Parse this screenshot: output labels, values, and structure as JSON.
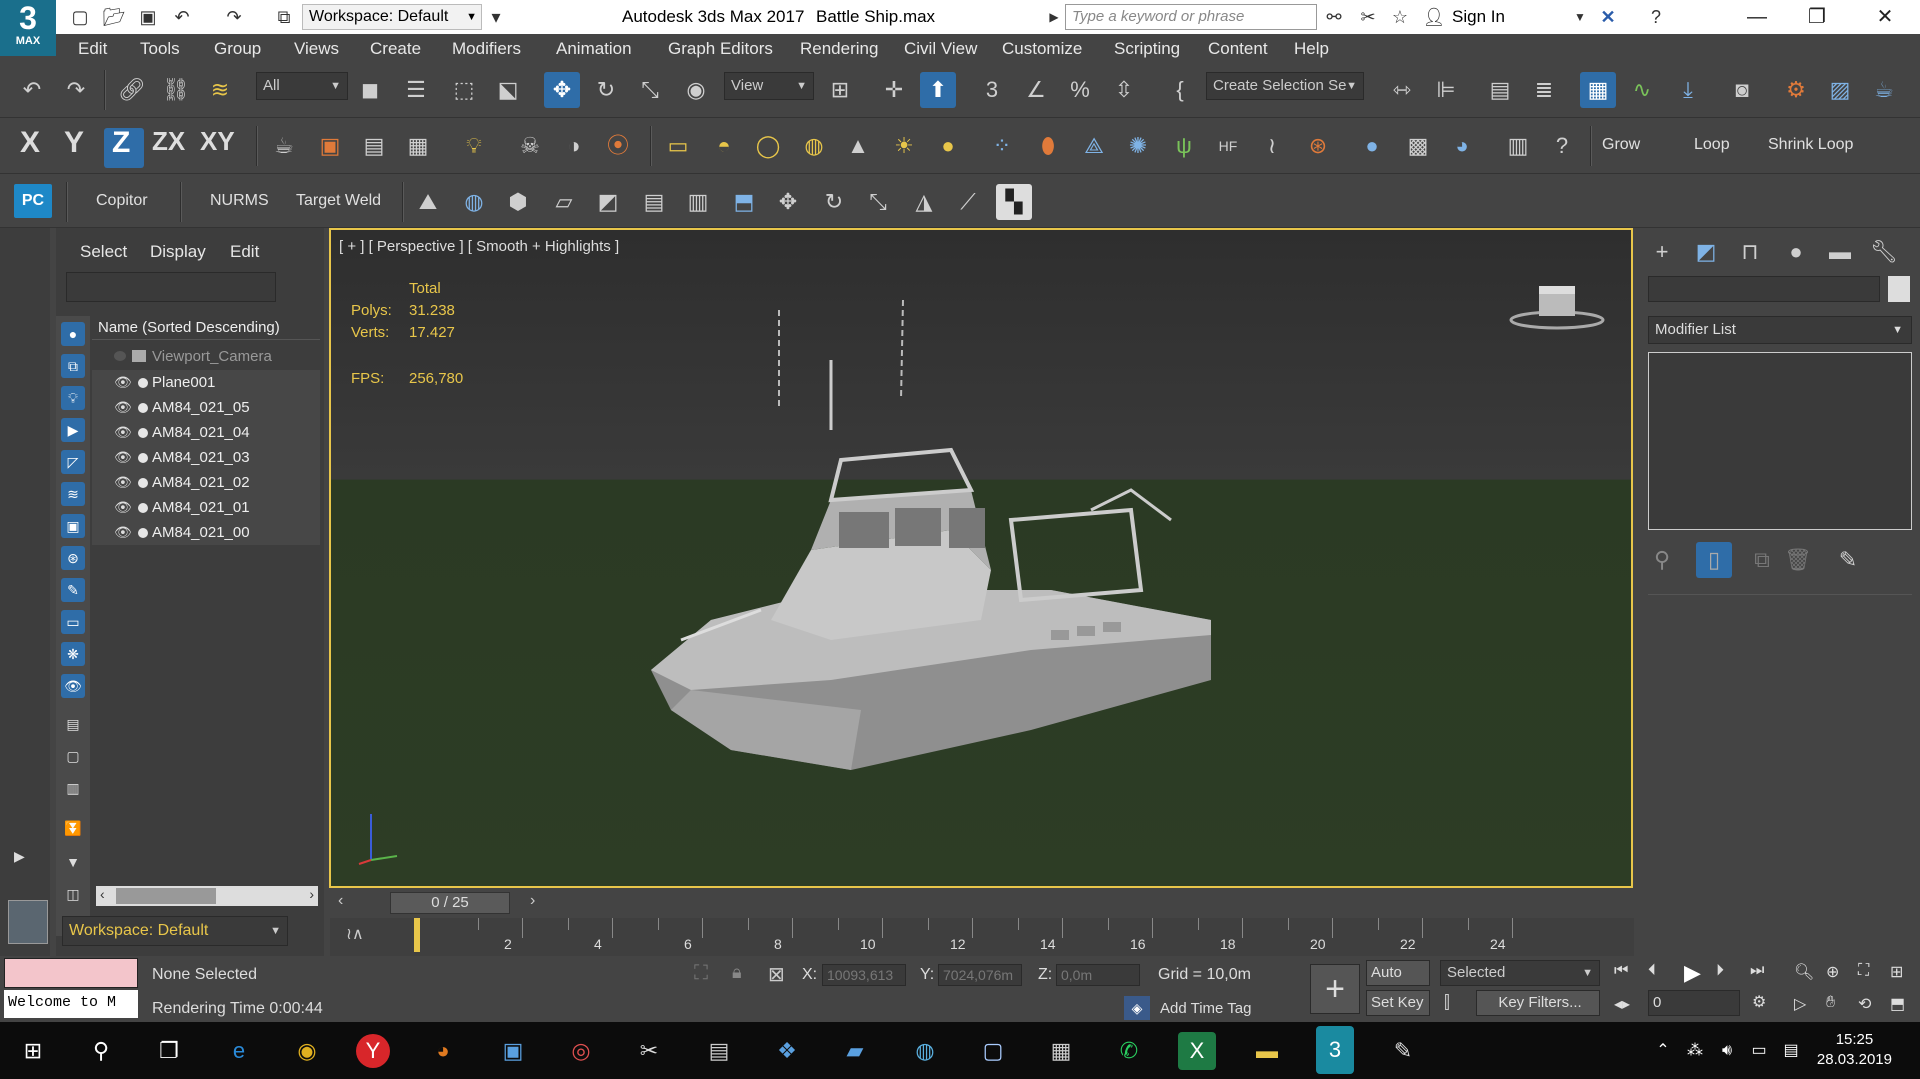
{
  "app": {
    "logo_text": "3",
    "logo_sub": "MAX",
    "workspace": "Workspace: Default",
    "title": "Autodesk 3ds Max 2017",
    "file": "Battle Ship.max",
    "search_placeholder": "Type a keyword or phrase",
    "sign_in": "Sign In"
  },
  "menu": [
    "Edit",
    "Tools",
    "Group",
    "Views",
    "Create",
    "Modifiers",
    "Animation",
    "Graph Editors",
    "Rendering",
    "Civil View",
    "Customize",
    "Scripting",
    "Content",
    "Help"
  ],
  "toolbar1": {
    "selection_filter": "All",
    "ref_coord": "View",
    "named_selection": "Create Selection Se"
  },
  "toolbar2": {
    "axes": [
      "X",
      "Y",
      "Z",
      "ZX",
      "XY"
    ],
    "active_axis": "Z",
    "grow": "Grow",
    "loop": "Loop",
    "shrink_loop": "Shrink Loop"
  },
  "toolbar3": {
    "pc_label": "PC",
    "copitor": "Copitor",
    "nurms": "NURMS",
    "target_weld": "Target Weld"
  },
  "explorer": {
    "tabs": [
      "Select",
      "Display",
      "Edit"
    ],
    "header": "Name (Sorted Descending)",
    "items": [
      {
        "name": "Viewport_Camera",
        "dim": true
      },
      {
        "name": "Plane001",
        "dim": false
      },
      {
        "name": "AM84_021_05",
        "dim": false
      },
      {
        "name": "AM84_021_04",
        "dim": false
      },
      {
        "name": "AM84_021_03",
        "dim": false
      },
      {
        "name": "AM84_021_02",
        "dim": false
      },
      {
        "name": "AM84_021_01",
        "dim": false
      },
      {
        "name": "AM84_021_00",
        "dim": false
      }
    ],
    "workspace": "Workspace: Default"
  },
  "viewport": {
    "label": "[ + ] [ Perspective ] [ Smooth + Highlights ]",
    "stats": {
      "total_label": "Total",
      "polys_label": "Polys:",
      "polys": "31.238",
      "verts_label": "Verts:",
      "verts": "17.427",
      "fps_label": "FPS:",
      "fps": "256,780"
    }
  },
  "command_panel": {
    "modifier_list": "Modifier List"
  },
  "timeline": {
    "frame": "0 / 25",
    "ticks": [
      "2",
      "4",
      "6",
      "8",
      "10",
      "12",
      "14",
      "16",
      "18",
      "20",
      "22",
      "24"
    ]
  },
  "status": {
    "welcome": "Welcome to M",
    "selection": "None Selected",
    "rendering_time": "Rendering Time  0:00:44",
    "x_label": "X:",
    "x_value": "10093,613",
    "y_label": "Y:",
    "y_value": "7024,076m",
    "z_label": "Z:",
    "z_value": "0,0m",
    "grid": "Grid = 10,0m",
    "add_time_tag": "Add Time Tag",
    "auto_key": "Auto Key",
    "selected": "Selected",
    "set_key": "Set Key",
    "key_filters": "Key Filters...",
    "frame_field": "0"
  },
  "taskbar": {
    "time": "15:25",
    "date": "28.03.2019"
  }
}
